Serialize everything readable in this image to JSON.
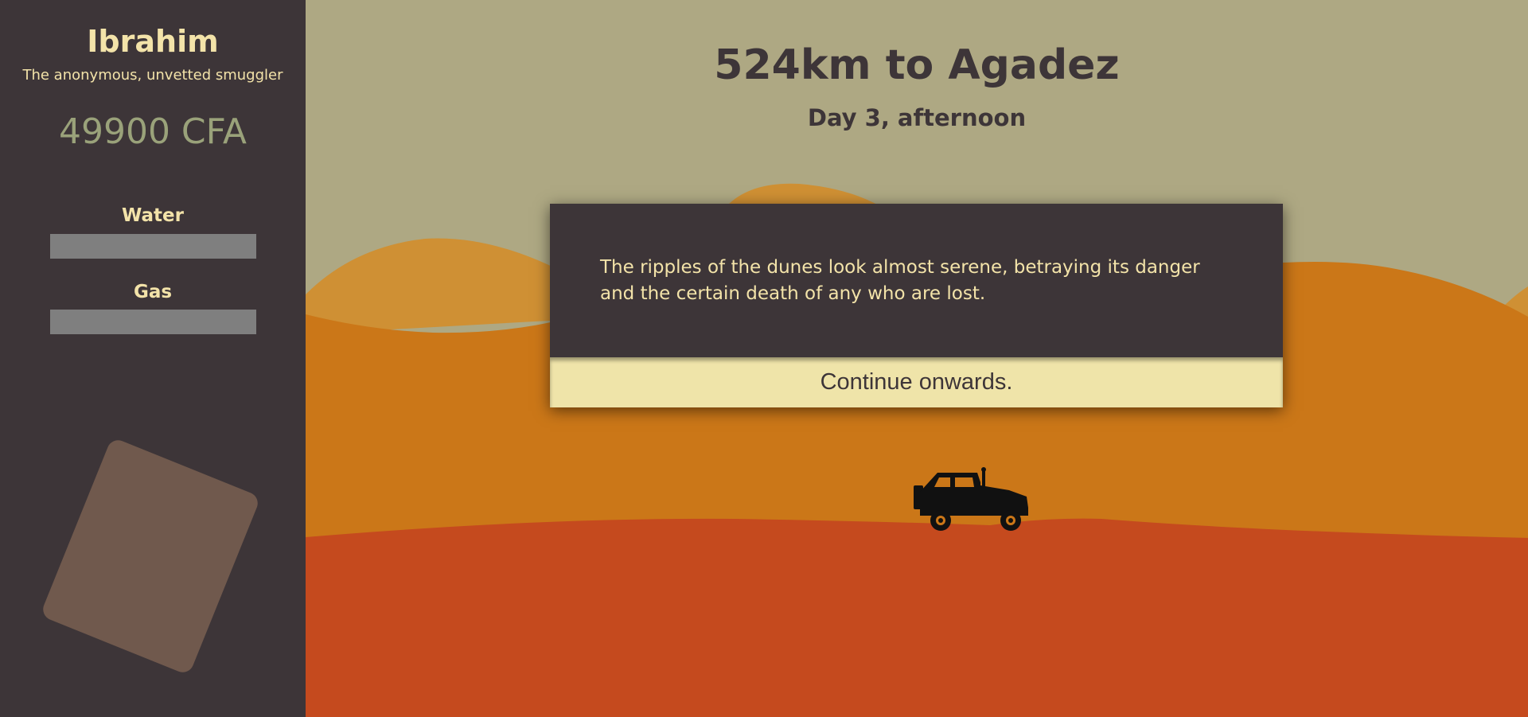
{
  "player": {
    "name": "Ibrahim",
    "title": "The anonymous, unvetted smuggler",
    "money": "49900 CFA"
  },
  "resources": [
    {
      "label": "Water",
      "level": 1.0
    },
    {
      "label": "Gas",
      "level": 1.0
    }
  ],
  "trip": {
    "distance": "524km to Agadez",
    "time": "Day 3, afternoon"
  },
  "event": {
    "text": "The ripples of the dunes look almost serene, betraying its danger and the certain death of any who are lost.",
    "action_label": "Continue onwards."
  },
  "colors": {
    "sidebar": "#3d3538",
    "sky": "#aea883",
    "far_dune": "#cf9034",
    "mid_dune": "#cb7718",
    "ground": "#c54a1e",
    "accent_text": "#f3e3a9",
    "money": "#9aa27a",
    "button": "#efe4a9"
  },
  "icons": {
    "vehicle": "jeep-icon"
  }
}
